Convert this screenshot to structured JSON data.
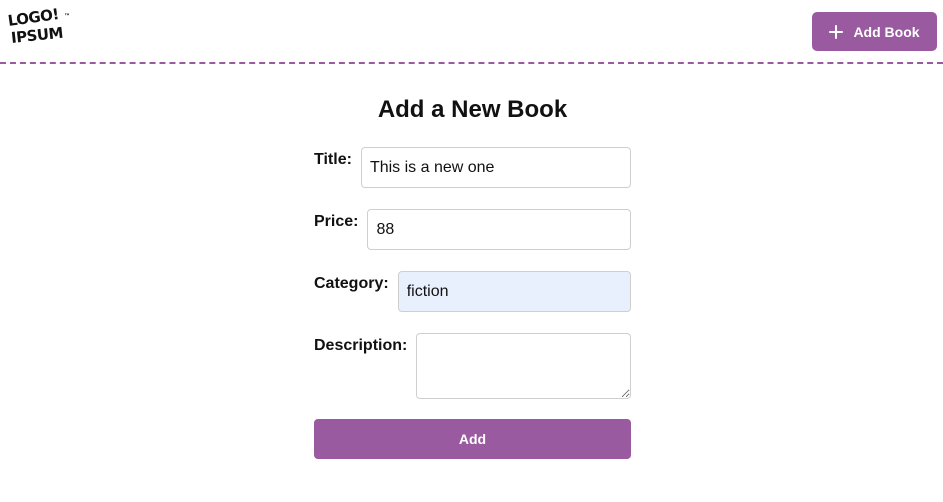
{
  "header": {
    "logo": {
      "line1": "LOGO!",
      "line2": "IPSUM",
      "tm": "™"
    },
    "add_book_button": {
      "icon": "plus-icon",
      "label": "Add Book"
    }
  },
  "main": {
    "title": "Add a New Book",
    "form": {
      "title": {
        "label": "Title:",
        "value": "This is a new one"
      },
      "price": {
        "label": "Price:",
        "value": "88"
      },
      "category": {
        "label": "Category:",
        "value": "fiction"
      },
      "description": {
        "label": "Description:",
        "value": ""
      },
      "submit_label": "Add"
    }
  },
  "colors": {
    "accent": "#9a5aa0",
    "autofill_background": "#e8f0fe",
    "input_border": "#cfcfcf"
  }
}
